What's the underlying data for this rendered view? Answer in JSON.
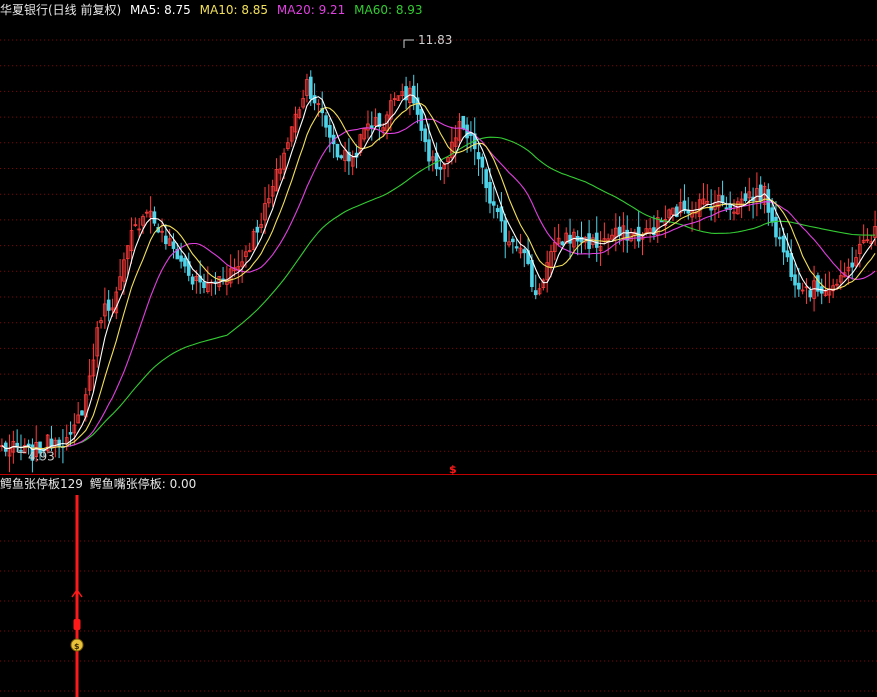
{
  "main_legend": {
    "title": "华夏银行(日线 前复权)",
    "items": [
      {
        "label": "MA5: 8.75",
        "color": "#ffffff"
      },
      {
        "label": "MA10: 8.85",
        "color": "#f2e05a"
      },
      {
        "label": "MA20: 9.21",
        "color": "#e040e0"
      },
      {
        "label": "MA60: 8.93",
        "color": "#33cc33"
      }
    ]
  },
  "indicator_legend": {
    "name": "鳄鱼张停板129",
    "value_label": "鳄鱼嘴张停板: 0.00"
  },
  "annotations": {
    "high_label": "11.83",
    "low_label": "4.93",
    "divider_marker": "$",
    "marker_dollar": "$"
  },
  "colors": {
    "up": "#ff3b3b",
    "down": "#4fd3e8",
    "grid": "#8a0000",
    "divider": "#c00000",
    "ma5": "#ffffff",
    "ma10": "#f2e05a",
    "ma20": "#e040e0",
    "ma60": "#33cc33",
    "signal": "#ff1a1a",
    "marker": "#e8c23a"
  },
  "chart_data": {
    "type": "candlestick",
    "ylim": [
      4.6,
      12.2
    ],
    "high": 11.83,
    "low": 4.93,
    "n": 230,
    "anchors": [
      [
        0,
        5.05
      ],
      [
        8,
        4.95
      ],
      [
        14,
        5.2
      ],
      [
        18,
        5.15
      ],
      [
        22,
        5.9
      ],
      [
        26,
        7.3
      ],
      [
        30,
        7.6
      ],
      [
        34,
        8.6
      ],
      [
        38,
        9.1
      ],
      [
        42,
        8.6
      ],
      [
        46,
        8.3
      ],
      [
        50,
        7.85
      ],
      [
        54,
        7.75
      ],
      [
        58,
        7.95
      ],
      [
        62,
        8.1
      ],
      [
        66,
        8.6
      ],
      [
        70,
        9.2
      ],
      [
        76,
        10.4
      ],
      [
        80,
        11.2
      ],
      [
        84,
        10.6
      ],
      [
        88,
        10.0
      ],
      [
        92,
        9.9
      ],
      [
        96,
        10.5
      ],
      [
        100,
        10.5
      ],
      [
        104,
        11.1
      ],
      [
        108,
        10.9
      ],
      [
        112,
        9.8
      ],
      [
        116,
        9.8
      ],
      [
        120,
        10.4
      ],
      [
        124,
        10.1
      ],
      [
        128,
        9.2
      ],
      [
        132,
        8.6
      ],
      [
        136,
        8.5
      ],
      [
        140,
        7.6
      ],
      [
        144,
        8.3
      ],
      [
        148,
        8.6
      ],
      [
        152,
        8.55
      ],
      [
        156,
        8.45
      ],
      [
        160,
        8.6
      ],
      [
        164,
        8.65
      ],
      [
        168,
        8.6
      ],
      [
        172,
        8.8
      ],
      [
        176,
        9.0
      ],
      [
        180,
        9.1
      ],
      [
        184,
        9.15
      ],
      [
        188,
        9.2
      ],
      [
        192,
        9.1
      ],
      [
        196,
        9.3
      ],
      [
        200,
        9.3
      ],
      [
        204,
        8.5
      ],
      [
        208,
        7.9
      ],
      [
        212,
        7.7
      ],
      [
        216,
        7.75
      ],
      [
        220,
        7.8
      ],
      [
        224,
        8.3
      ],
      [
        229,
        8.7
      ]
    ],
    "indicator": {
      "name": "鳄鱼嘴张停板",
      "value": 0.0,
      "signal_bar_index": 20
    }
  }
}
